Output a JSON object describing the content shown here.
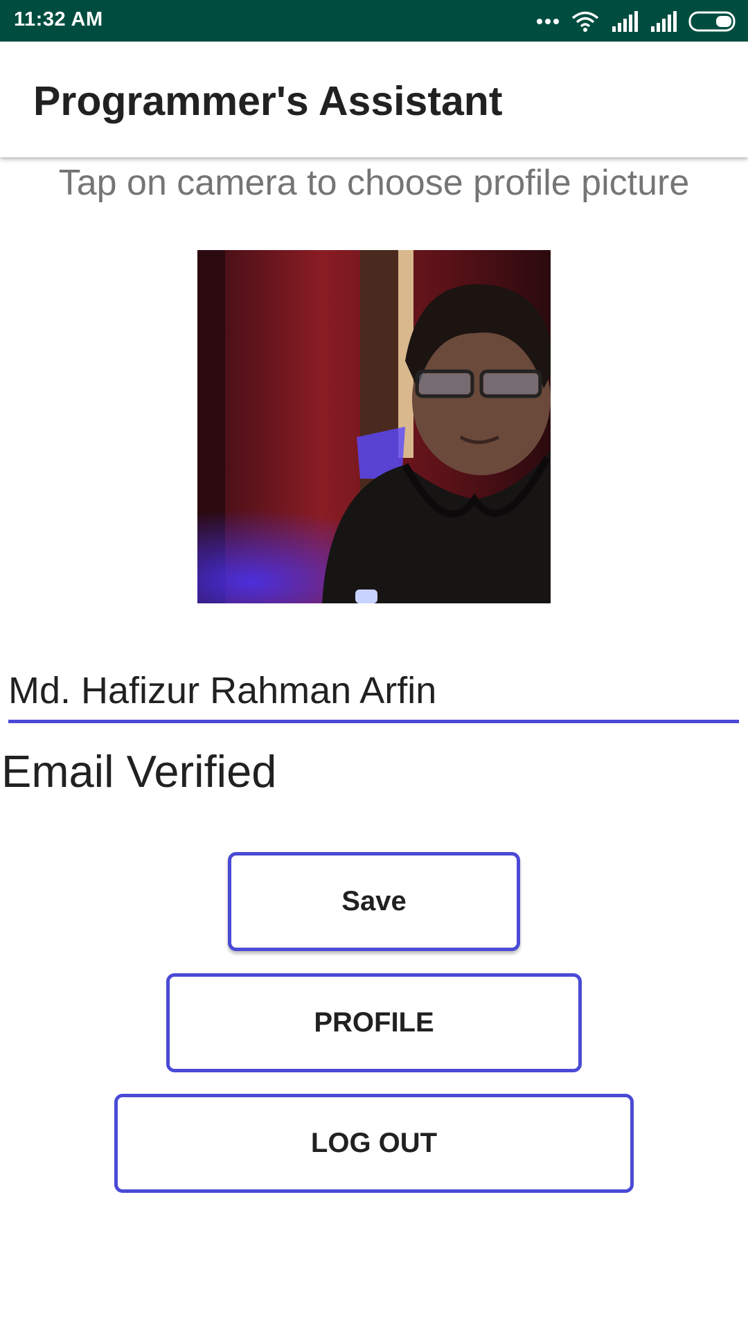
{
  "status_bar": {
    "time": "11:32 AM",
    "icons": [
      "more-dots-icon",
      "wifi-icon",
      "signal-icon",
      "signal-icon",
      "battery-icon"
    ]
  },
  "app_bar": {
    "title": "Programmer's Assistant"
  },
  "profile": {
    "hint": "Tap on camera to choose profile picture",
    "photo_icon": "profile-photo",
    "name_value": "Md. Hafizur Rahman Arfin",
    "email_status": "Email Verified"
  },
  "buttons": {
    "save": "Save",
    "profile": "PROFILE",
    "logout": "LOG OUT"
  },
  "colors": {
    "status_bar": "#004d40",
    "accent": "#4a4ad6",
    "hint_text": "#757575"
  }
}
